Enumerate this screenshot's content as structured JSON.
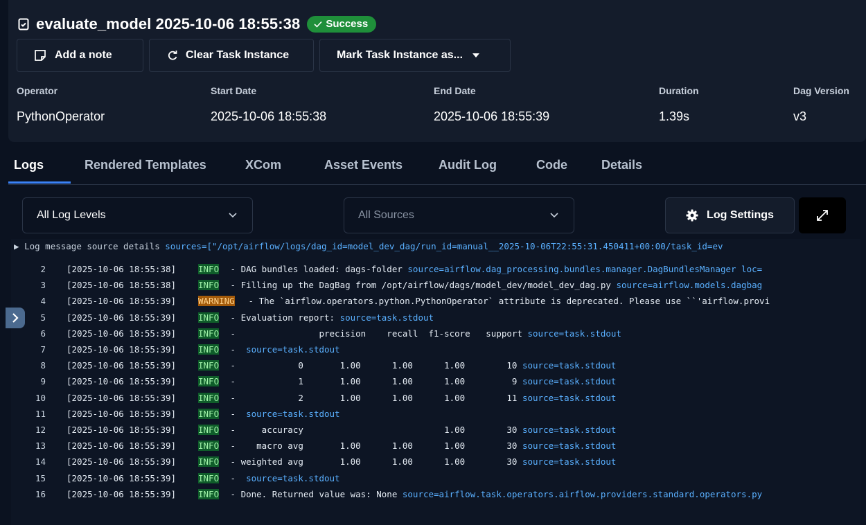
{
  "header": {
    "title": "evaluate_model 2025-10-06 18:55:38",
    "status": "Success",
    "status_color": "#1f8f3a"
  },
  "actions": {
    "add_note": "Add a note",
    "clear_task": "Clear Task Instance",
    "mark_task": "Mark Task Instance as..."
  },
  "details": [
    {
      "label": "Operator",
      "value": "PythonOperator"
    },
    {
      "label": "Start Date",
      "value": "2025-10-06 18:55:38"
    },
    {
      "label": "End Date",
      "value": "2025-10-06 18:55:39"
    },
    {
      "label": "Duration",
      "value": "1.39s"
    },
    {
      "label": "Dag Version",
      "value": "v3"
    }
  ],
  "tabs": [
    "Logs",
    "Rendered Templates",
    "XCom",
    "Asset Events",
    "Audit Log",
    "Code",
    "Details"
  ],
  "active_tab": "Logs",
  "filters": {
    "log_levels": "All Log Levels",
    "sources": "All Sources",
    "log_settings": "Log Settings"
  },
  "log_summary": {
    "prefix": "Log message source details",
    "source_text": "sources=[\"/opt/airflow/logs/dag_id=model_dev_dag/run_id=manual__2025-10-06T22:55:31.450411+00:00/task_id=ev"
  },
  "logs": [
    {
      "n": "2",
      "ts": "[2025-10-06 18:55:38]",
      "level": "INFO",
      "msg": "- DAG bundles loaded: dags-folder ",
      "src": "source=airflow.dag_processing.bundles.manager.DagBundlesManager loc="
    },
    {
      "n": "3",
      "ts": "[2025-10-06 18:55:38]",
      "level": "INFO",
      "msg": "- Filling up the DagBag from /opt/airflow/dags/model_dev/model_dev_dag.py ",
      "src": "source=airflow.models.dagbag"
    },
    {
      "n": "4",
      "ts": "[2025-10-06 18:55:39]",
      "level": "WARNING",
      "msg": "- The `airflow.operators.python.PythonOperator` attribute is deprecated. Please use ``'airflow.provi",
      "src": ""
    },
    {
      "n": "5",
      "ts": "[2025-10-06 18:55:39]",
      "level": "INFO",
      "msg": "- Evaluation report: ",
      "src": "source=task.stdout"
    },
    {
      "n": "6",
      "ts": "[2025-10-06 18:55:39]",
      "level": "INFO",
      "msg": "-                precision    recall  f1-score   support ",
      "src": "source=task.stdout"
    },
    {
      "n": "7",
      "ts": "[2025-10-06 18:55:39]",
      "level": "INFO",
      "msg": "-  ",
      "src": "source=task.stdout"
    },
    {
      "n": "8",
      "ts": "[2025-10-06 18:55:39]",
      "level": "INFO",
      "msg": "-            0       1.00      1.00      1.00        10 ",
      "src": "source=task.stdout"
    },
    {
      "n": "9",
      "ts": "[2025-10-06 18:55:39]",
      "level": "INFO",
      "msg": "-            1       1.00      1.00      1.00         9 ",
      "src": "source=task.stdout"
    },
    {
      "n": "10",
      "ts": "[2025-10-06 18:55:39]",
      "level": "INFO",
      "msg": "-            2       1.00      1.00      1.00        11 ",
      "src": "source=task.stdout"
    },
    {
      "n": "11",
      "ts": "[2025-10-06 18:55:39]",
      "level": "INFO",
      "msg": "-  ",
      "src": "source=task.stdout"
    },
    {
      "n": "12",
      "ts": "[2025-10-06 18:55:39]",
      "level": "INFO",
      "msg": "-     accuracy                           1.00        30 ",
      "src": "source=task.stdout"
    },
    {
      "n": "13",
      "ts": "[2025-10-06 18:55:39]",
      "level": "INFO",
      "msg": "-    macro avg       1.00      1.00      1.00        30 ",
      "src": "source=task.stdout"
    },
    {
      "n": "14",
      "ts": "[2025-10-06 18:55:39]",
      "level": "INFO",
      "msg": "- weighted avg       1.00      1.00      1.00        30 ",
      "src": "source=task.stdout"
    },
    {
      "n": "15",
      "ts": "[2025-10-06 18:55:39]",
      "level": "INFO",
      "msg": "-  ",
      "src": "source=task.stdout"
    },
    {
      "n": "16",
      "ts": "[2025-10-06 18:55:39]",
      "level": "INFO",
      "msg": "- Done. Returned value was: None ",
      "src": "source=airflow.task.operators.airflow.providers.standard.operators.py"
    }
  ]
}
